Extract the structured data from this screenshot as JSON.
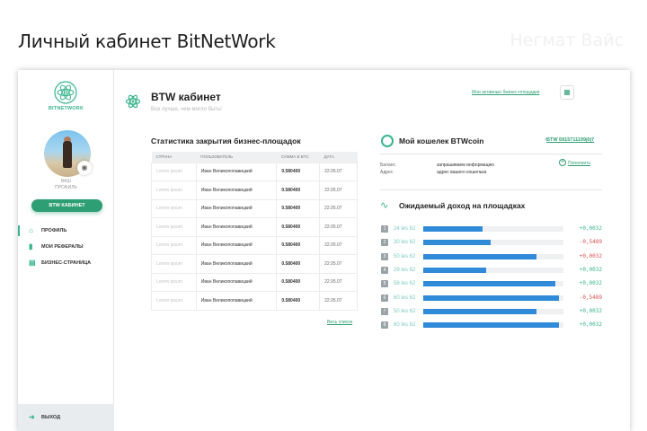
{
  "page": {
    "title": "Личный кабинет BitNetWork",
    "author": "Негмат Вайс"
  },
  "sidebar": {
    "logo_text": "BITNETWORK",
    "profile_label_1": "ВАШ",
    "profile_label_2": "ПРОФИЛЬ",
    "cabinet_button": "BTW КАБИНЕТ",
    "nav": [
      {
        "label": "ПРОФИЛЬ",
        "icon": "home-icon",
        "active": true
      },
      {
        "label": "МОИ РЕФЕРАЛЫ",
        "icon": "bar-chart-icon",
        "active": false
      },
      {
        "label": "БИЗНЕС-СТРАНИЦА",
        "icon": "document-icon",
        "active": false
      }
    ],
    "logout": "ВЫХОД"
  },
  "header": {
    "title": "BTW кабинет",
    "subtitle": "Все лучше, чем могло быть!",
    "active_link": "Мои активные бизнес-площадки"
  },
  "stats": {
    "title": "Статистика закрытия бизнес-площадок",
    "columns": [
      "СТРАНА",
      "ПОЛЬЗОВАТЕЛЬ",
      "СУММА В BTC",
      "ДАТА"
    ],
    "rows": [
      [
        "Lorem ipsum",
        "Иван Великопопавицкий",
        "0.580400",
        "22.05.07"
      ],
      [
        "Lorem ipsum",
        "Иван Великопопавицкий",
        "0.580400",
        "22.05.07"
      ],
      [
        "Lorem ipsum",
        "Иван Великопопавицкий",
        "0.580400",
        "22.05.07"
      ],
      [
        "Lorem ipsum",
        "Иван Великопопавицкий",
        "0.580400",
        "22.05.07"
      ],
      [
        "Lorem ipsum",
        "Иван Великопопавицкий",
        "0.580400",
        "22.05.07"
      ],
      [
        "Lorem ipsum",
        "Иван Великопопавицкий",
        "0.580400",
        "22.05.07"
      ],
      [
        "Lorem ipsum",
        "Иван Великопопавицкий",
        "0.580400",
        "22.05.07"
      ],
      [
        "Lorem ipsum",
        "Иван Великопопавицкий",
        "0.580400",
        "22.05.07"
      ]
    ],
    "all_link": "Весь список"
  },
  "wallet": {
    "title": "Мой кошелек BTWcoin",
    "address": "BTW 6915711199j0j7",
    "balance_label": "Баланс",
    "balance_value": "запрашиваем информацию",
    "address_label": "Адрес",
    "address_value": "адрес вашего кошелька",
    "topup": "Пополнить"
  },
  "income": {
    "title": "Ожидаемый доход на площадках",
    "rows": [
      {
        "num": "1",
        "label": "24 lеs 62",
        "fill": 0.42,
        "value": "+0,0032",
        "sign": "pos"
      },
      {
        "num": "2",
        "label": "30 lеs 62",
        "fill": 0.48,
        "value": "-0,5489",
        "sign": "neg"
      },
      {
        "num": "3",
        "label": "50 lеs 62",
        "fill": 0.81,
        "value": "+0,0032",
        "sign": "neg"
      },
      {
        "num": "4",
        "label": "29 lеs 62",
        "fill": 0.45,
        "value": "+0,0032",
        "sign": "pos"
      },
      {
        "num": "5",
        "label": "58 lеs 62",
        "fill": 0.94,
        "value": "+0,0032",
        "sign": "pos"
      },
      {
        "num": "6",
        "label": "60 lеs 62",
        "fill": 0.97,
        "value": "-0,5489",
        "sign": "neg"
      },
      {
        "num": "7",
        "label": "50 lеs 62",
        "fill": 0.81,
        "value": "+0,0032",
        "sign": "pos"
      },
      {
        "num": "8",
        "label": "60 lеs 62",
        "fill": 0.97,
        "value": "+0,0032",
        "sign": "pos"
      }
    ]
  },
  "colors": {
    "accent": "#38b48b",
    "button": "#2e9e74",
    "bar": "#2f8ad8",
    "negative": "#e05252"
  }
}
